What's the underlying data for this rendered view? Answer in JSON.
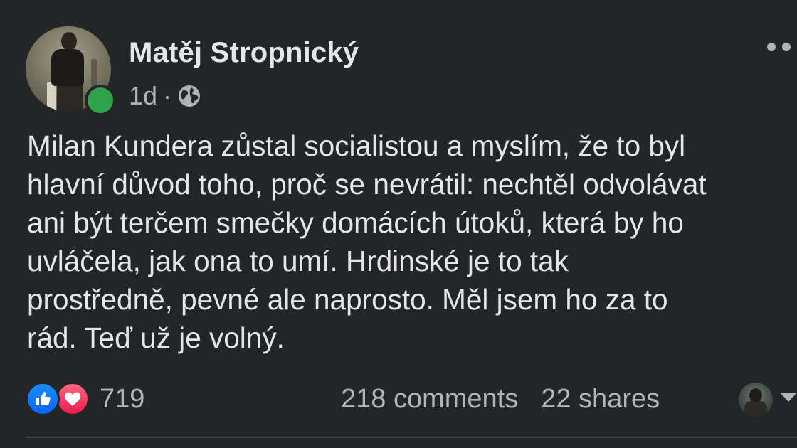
{
  "post": {
    "author": "Matěj Stropnický",
    "timestamp": "1d",
    "separator": "·",
    "audience_icon": "globe-icon",
    "menu_icon": "more-options-icon",
    "text": "Milan Kundera zůstal socialistou a myslím, že to byl\nhlavní důvod toho, proč se nevrátil: nechtěl odvolávat\nani být terčem smečky domácích útoků, která by ho\nuvláčela, jak ona to umí. Hrdinské je to tak\nprostředně, pevné ale naprosto. Měl jsem ho za to\nrád. Teď už je volný.",
    "online": true
  },
  "reactions": {
    "types": [
      "like",
      "love"
    ],
    "count": "719"
  },
  "engagement": {
    "comments": "218 comments",
    "shares": "22 shares"
  },
  "colors": {
    "background": "#242526",
    "text_primary": "#e4e6eb",
    "text_secondary": "#b0b3b8",
    "online": "#31a24c",
    "like": "#1877f2",
    "love": "#f33e58"
  }
}
